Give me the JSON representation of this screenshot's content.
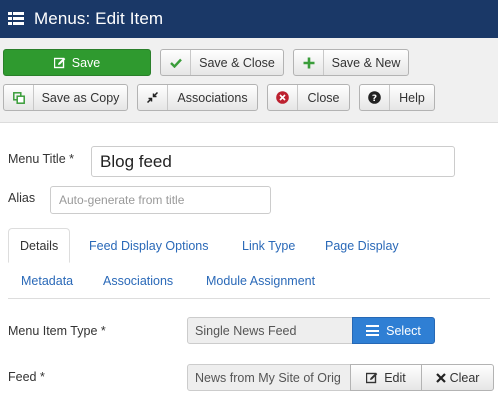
{
  "header": {
    "title": "Menus: Edit Item",
    "icon": "menu-list-icon",
    "bg_color": "#1a3867"
  },
  "toolbar": {
    "save_label": "Save",
    "save_close_label": "Save & Close",
    "save_new_label": "Save & New",
    "save_copy_label": "Save as Copy",
    "associations_label": "Associations",
    "close_label": "Close",
    "help_label": "Help",
    "save_color": "#2f9a2f",
    "close_icon_color": "#bd2130"
  },
  "form": {
    "menu_title_label": "Menu Title *",
    "menu_title_value": "Blog feed",
    "alias_label": "Alias",
    "alias_placeholder": "Auto-generate from title"
  },
  "tabs": [
    {
      "label": "Details",
      "active": true
    },
    {
      "label": "Feed Display Options"
    },
    {
      "label": "Link Type"
    },
    {
      "label": "Page Display"
    },
    {
      "label": "Metadata"
    },
    {
      "label": "Associations"
    },
    {
      "label": "Module Assignment"
    }
  ],
  "details": {
    "menu_item_type_label": "Menu Item Type *",
    "menu_item_type_value": "Single News Feed",
    "select_label": "Select",
    "feed_label": "Feed *",
    "feed_value": "News from My Site of Orig",
    "edit_label": "Edit",
    "clear_label": "Clear"
  }
}
